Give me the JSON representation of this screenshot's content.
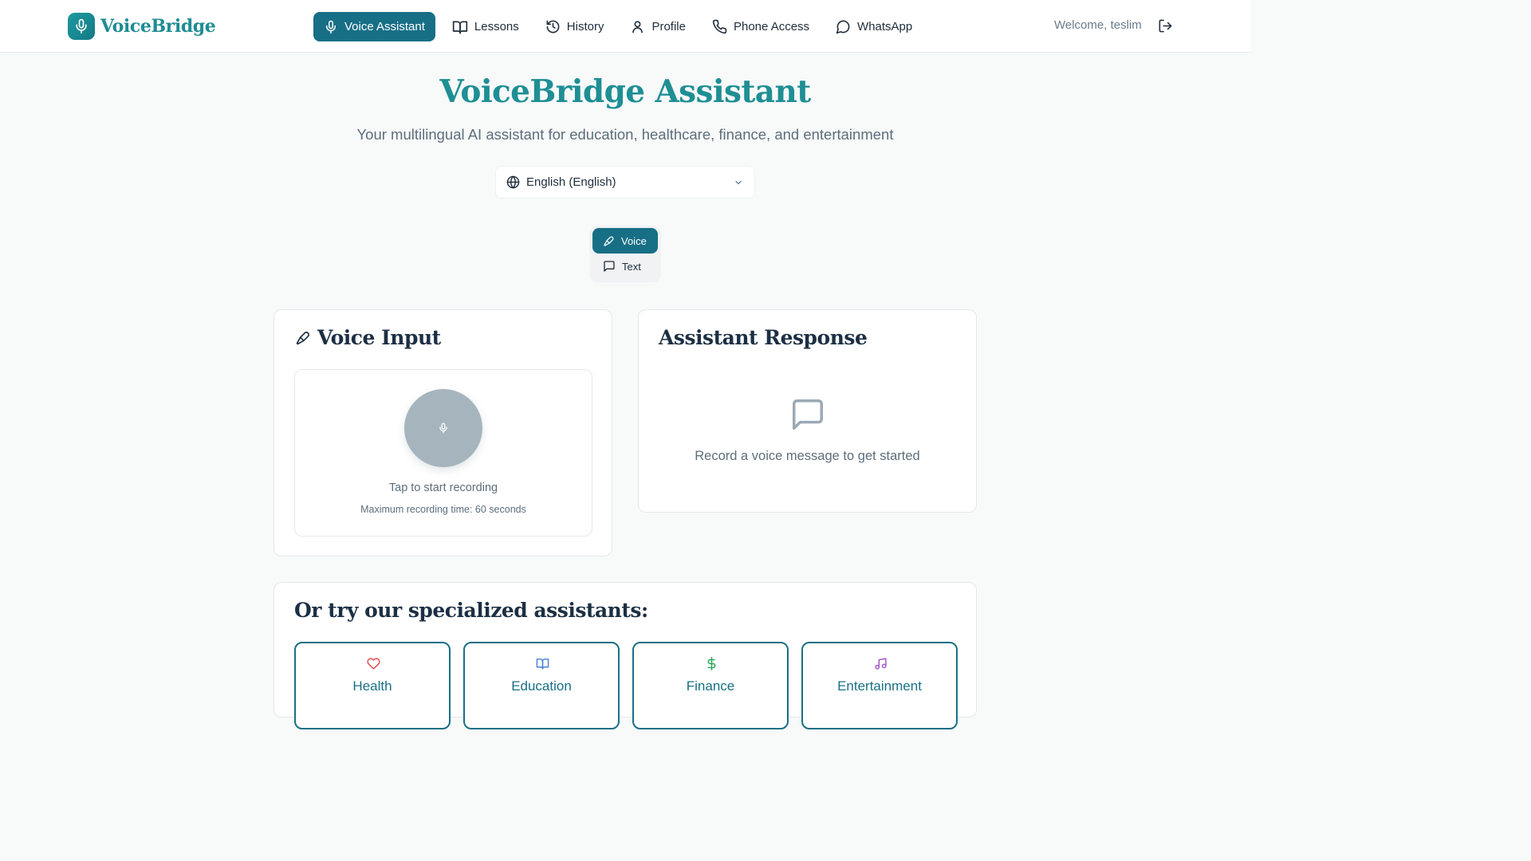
{
  "header": {
    "brand_name": "VoiceBridge",
    "nav": [
      {
        "label": "Voice Assistant",
        "icon": "mic-icon",
        "active": true
      },
      {
        "label": "Lessons",
        "icon": "book-open-icon",
        "active": false
      },
      {
        "label": "History",
        "icon": "history-icon",
        "active": false
      },
      {
        "label": "Profile",
        "icon": "user-icon",
        "active": false
      },
      {
        "label": "Phone Access",
        "icon": "phone-icon",
        "active": false
      },
      {
        "label": "WhatsApp",
        "icon": "chat-bubble-icon",
        "active": false
      }
    ],
    "welcome_text": "Welcome, teslim",
    "logout_icon": "logout-icon"
  },
  "hero": {
    "title": "VoiceBridge Assistant",
    "subtitle": "Your multilingual AI assistant for education, healthcare, finance, and entertainment"
  },
  "language_select": {
    "value": "English (English)",
    "icon": "globe-icon"
  },
  "mode_toggle": {
    "voice_label": "Voice",
    "text_label": "Text",
    "selected": "Voice"
  },
  "voice_input": {
    "title": "Voice Input",
    "hint": "Tap to start recording",
    "max_time": "Maximum recording time: 60 seconds"
  },
  "assistant_response": {
    "title": "Assistant Response",
    "empty_text": "Record a voice message to get started"
  },
  "specialized": {
    "title": "Or try our specialized assistants:",
    "items": [
      {
        "label": "Health",
        "icon": "heart-icon",
        "color": "#e0484b"
      },
      {
        "label": "Education",
        "icon": "book-open-icon",
        "color": "#4a7fd6"
      },
      {
        "label": "Finance",
        "icon": "dollar-icon",
        "color": "#24a55a"
      },
      {
        "label": "Entertainment",
        "icon": "music-icon",
        "color": "#a052c8"
      }
    ]
  },
  "colors": {
    "primary": "#176f86",
    "brand_text": "#1e8f94",
    "background": "#f8f9f9",
    "muted_text": "#5d6e7c"
  }
}
